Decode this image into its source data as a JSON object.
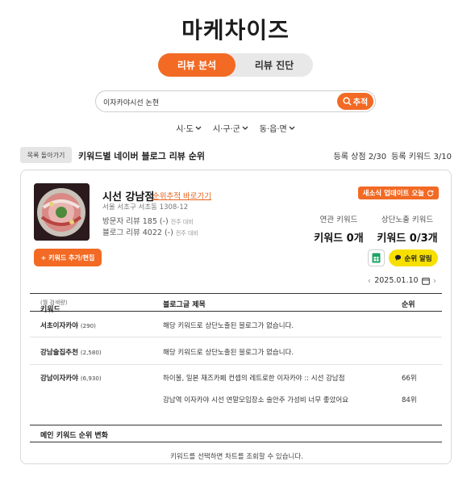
{
  "app": {
    "logo": "마케차이즈"
  },
  "tabs": [
    {
      "label": "리뷰 분석",
      "active": true
    },
    {
      "label": "리뷰 진단",
      "active": false
    }
  ],
  "search": {
    "value": "이자카야시선 논현",
    "button_label": "추적"
  },
  "regions": [
    "시·도",
    "시·구·군",
    "동·읍·면"
  ],
  "toolbar": {
    "back_label": "목록 돌아가기",
    "heading": "키워드별 네이버 블로그 리뷰 순위",
    "store_count": "등록 상점 2/30",
    "keyword_count": "등록 키워드 3/10"
  },
  "store": {
    "name": "시선 강남점",
    "rank_link": "순위추적 바로가기",
    "address": "서울 서초구 서초동 1308-12",
    "visitor_review_label": "방문자 리뷰",
    "visitor_review_value": "185 (-)",
    "visitor_review_note": "전주 대비",
    "blog_review_label": "블로그 리뷰",
    "blog_review_value": "4022 (-)",
    "blog_review_note": "전주 대비",
    "update_badge": "새소식 업데이트",
    "update_when": "오늘",
    "related_kw_label": "연관 키워드",
    "related_kw_value": "키워드 0개",
    "top_kw_label": "상단노출 키워드",
    "top_kw_value": "키워드 0/3개",
    "add_kw_label": "+ 키워드 추가/편집",
    "alert_label": "순위 알림",
    "date": "2025.01.10"
  },
  "table": {
    "col_keyword": "키워드",
    "col_keyword_note": "(월 검색량)",
    "col_title": "블로그글 제목",
    "col_rank": "순위",
    "rows": [
      {
        "keyword": "서초이자카야",
        "volume": "(290)",
        "entries": [
          {
            "title": "해당 키워드로 상단노출된 블로그가 없습니다.",
            "rank": ""
          }
        ]
      },
      {
        "keyword": "강남술집추천",
        "volume": "(2,580)",
        "entries": [
          {
            "title": "해당 키워드로 상단노출된 블로그가 없습니다.",
            "rank": ""
          }
        ]
      },
      {
        "keyword": "강남이자카야",
        "volume": "(6,930)",
        "entries": [
          {
            "title": "하이볼, 일본 재즈카페 컨셉의 레트로한 이자카야 :: 시선 강남점",
            "rank": "66위"
          },
          {
            "title": "강남역 이자카야 시선 연말모임장소 술안주 가성비 너무 좋았어요",
            "rank": "84위"
          }
        ]
      }
    ]
  },
  "rank_change": {
    "title": "메인 키워드 순위 변화",
    "note": "키워드를 선택하면 차트를 조회할 수 있습니다."
  },
  "colors": {
    "accent": "#f26a24",
    "alert": "#f7e000"
  },
  "icons": [
    "search-icon",
    "chevron-down-icon",
    "refresh-icon",
    "spreadsheet-icon",
    "chat-bubble-icon",
    "calendar-icon",
    "chevron-left-icon",
    "chevron-right-icon"
  ]
}
